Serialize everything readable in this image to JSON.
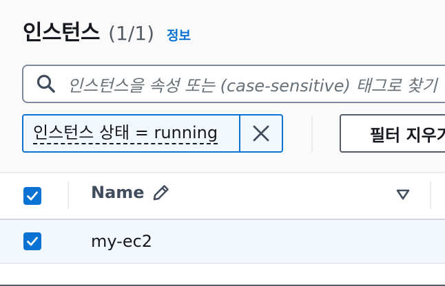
{
  "header": {
    "title": "인스턴스",
    "count": "(1/1)",
    "info_link": "정보"
  },
  "search": {
    "placeholder": "인스턴스을 속성 또는 (case-sensitive) 태그로 찾기"
  },
  "filter_token": {
    "label": "인스턴스 상태 = running"
  },
  "toolbar": {
    "clear_filters_label": "필터 지우기"
  },
  "table": {
    "columns": [
      {
        "label": "Name",
        "editable": true,
        "icon": "pencil-icon"
      }
    ],
    "rows": [
      {
        "name": "my-ec2",
        "selected": true
      }
    ],
    "select_all_checked": true
  },
  "colors": {
    "accent": "#0972d3",
    "selected_row_bg": "#f2f8fd",
    "border": "#7d8998"
  },
  "icons": {
    "search": "search-icon",
    "remove": "close-icon",
    "edit": "pencil-icon",
    "sort": "sort-down-icon",
    "check": "check-icon"
  }
}
